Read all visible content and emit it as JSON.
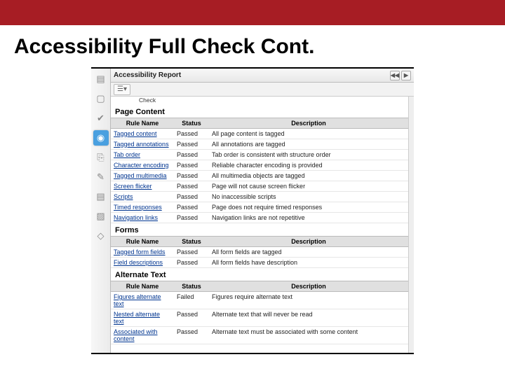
{
  "slide": {
    "title": "Accessibility Full Check Cont."
  },
  "panel": {
    "title": "Accessibility Report",
    "nav_prev": "◀◀",
    "nav_next": "▶",
    "toolbar_menu": "☰▾",
    "partial_check": "Check"
  },
  "rail": {
    "thumbnails": "▤",
    "bookmarks": "▢",
    "checker": "✔",
    "accessibility": "◉",
    "attachments": "⎘",
    "signatures": "✎",
    "layers": "▤",
    "order": "▨",
    "tags": "◇"
  },
  "cols": {
    "rule": "Rule Name",
    "status": "Status",
    "desc": "Description"
  },
  "status": {
    "passed": "Passed",
    "failed": "Failed"
  },
  "sections": {
    "page_content": {
      "title": "Page Content",
      "rows": [
        {
          "rule": "Tagged content",
          "status": "Passed",
          "desc": "All page content is tagged"
        },
        {
          "rule": "Tagged annotations",
          "status": "Passed",
          "desc": "All annotations are tagged"
        },
        {
          "rule": "Tab order",
          "status": "Passed",
          "desc": "Tab order is consistent with structure order"
        },
        {
          "rule": "Character encoding",
          "status": "Passed",
          "desc": "Reliable character encoding is provided"
        },
        {
          "rule": "Tagged multimedia",
          "status": "Passed",
          "desc": "All multimedia objects are tagged"
        },
        {
          "rule": "Screen flicker",
          "status": "Passed",
          "desc": "Page will not cause screen flicker"
        },
        {
          "rule": "Scripts",
          "status": "Passed",
          "desc": "No inaccessible scripts"
        },
        {
          "rule": "Timed responses",
          "status": "Passed",
          "desc": "Page does not require timed responses"
        },
        {
          "rule": "Navigation links",
          "status": "Passed",
          "desc": "Navigation links are not repetitive"
        }
      ]
    },
    "forms": {
      "title": "Forms",
      "rows": [
        {
          "rule": "Tagged form fields",
          "status": "Passed",
          "desc": "All form fields are tagged"
        },
        {
          "rule": "Field descriptions",
          "status": "Passed",
          "desc": "All form fields have description"
        }
      ]
    },
    "alternate_text": {
      "title": "Alternate Text",
      "rows": [
        {
          "rule": "Figures alternate text",
          "status": "Failed",
          "desc": "Figures require alternate text"
        },
        {
          "rule": "Nested alternate text",
          "status": "Passed",
          "desc": "Alternate text that will never be read"
        },
        {
          "rule": "Associated with content",
          "status": "Passed",
          "desc": "Alternate text must be associated with some content"
        }
      ]
    }
  }
}
